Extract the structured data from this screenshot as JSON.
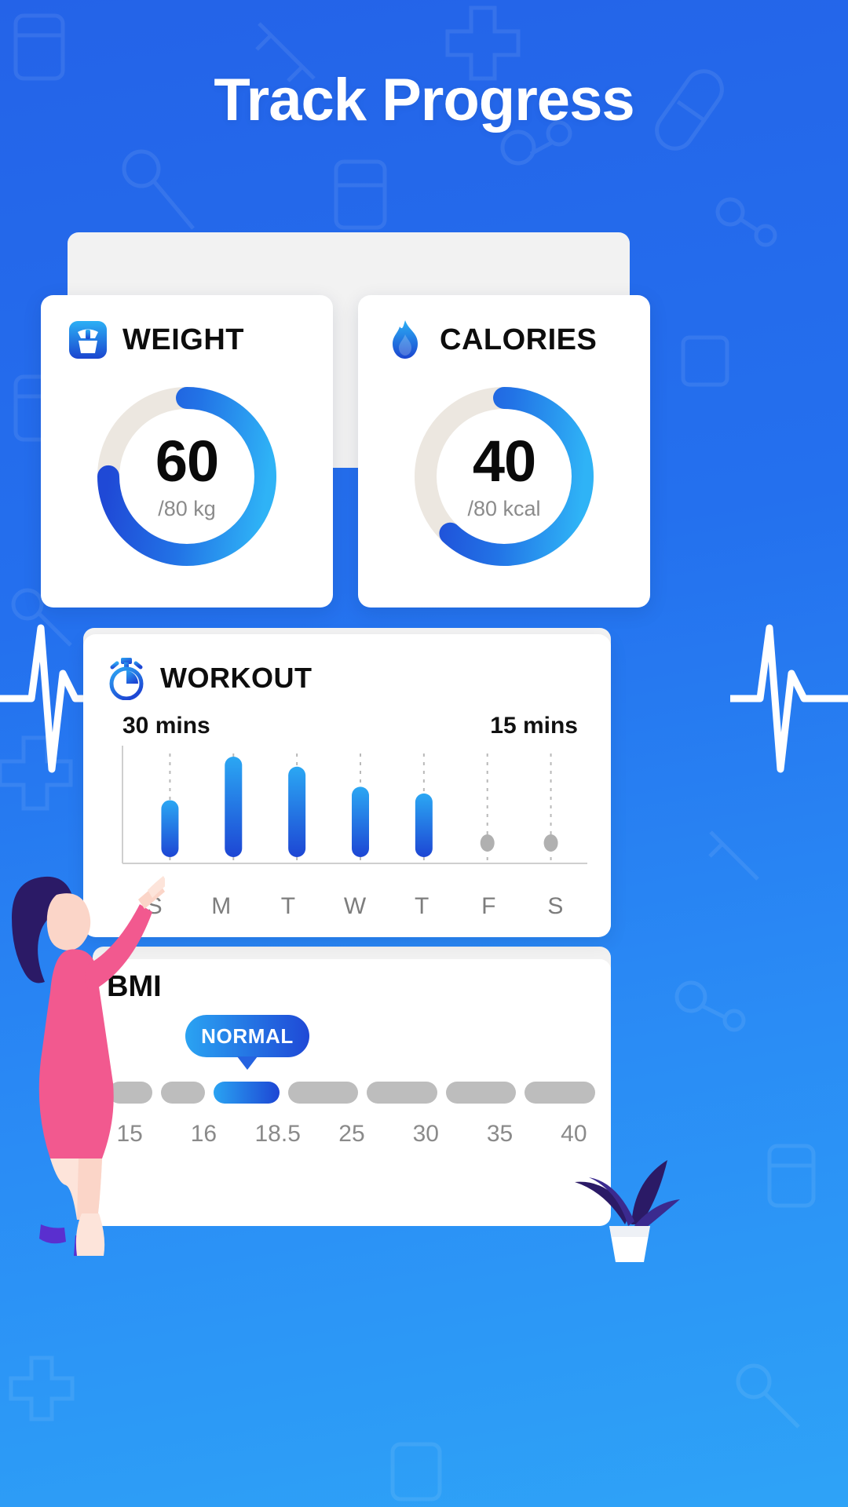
{
  "header": {
    "title": "Track Progress"
  },
  "theme": {
    "bg_blue_dark": "#2463e8",
    "bg_blue_light": "#2ea3f7",
    "accent_dark": "#1f49d6",
    "accent_light": "#2aa3f2",
    "track_color": "#ece7e0",
    "muted_gray": "#bdbdbd"
  },
  "cards": [
    {
      "id": "weight",
      "icon": "scale-icon",
      "title": "WEIGHT",
      "value": "60",
      "sub": "/80 kg",
      "percent": 75
    },
    {
      "id": "calories",
      "icon": "flame-icon",
      "title": "CALORIES",
      "value": "40",
      "sub": "/80 kcal",
      "percent": 62
    }
  ],
  "workout": {
    "icon": "stopwatch-icon",
    "title": "WORKOUT",
    "max_label": "30 mins",
    "min_label": "15 mins"
  },
  "bmi": {
    "title": "BMI",
    "badge": "NORMAL",
    "active_index": 2,
    "ticks": [
      "15",
      "16",
      "18.5",
      "25",
      "30",
      "35",
      "40"
    ],
    "segments": [
      {
        "flex": 1,
        "active": false
      },
      {
        "flex": 1,
        "active": false
      },
      {
        "flex": 1.5,
        "active": true
      },
      {
        "flex": 1.6,
        "active": false
      },
      {
        "flex": 1.6,
        "active": false
      },
      {
        "flex": 1.6,
        "active": false
      },
      {
        "flex": 1.6,
        "active": false
      }
    ]
  },
  "chart_data": {
    "type": "bar",
    "title": "WORKOUT",
    "xlabel": "",
    "ylabel": "mins",
    "categories": [
      "S",
      "M",
      "T",
      "W",
      "T",
      "F",
      "S"
    ],
    "values": [
      17,
      30,
      27,
      21,
      19,
      0,
      0
    ],
    "ylim": [
      0,
      30
    ],
    "grid": true,
    "legend": "none",
    "annotations": {
      "top_left": "30 mins",
      "top_right": "15 mins"
    },
    "empty_marker": "dot",
    "bar_gradient": [
      "#2aa3f2",
      "#1d46d4"
    ]
  }
}
